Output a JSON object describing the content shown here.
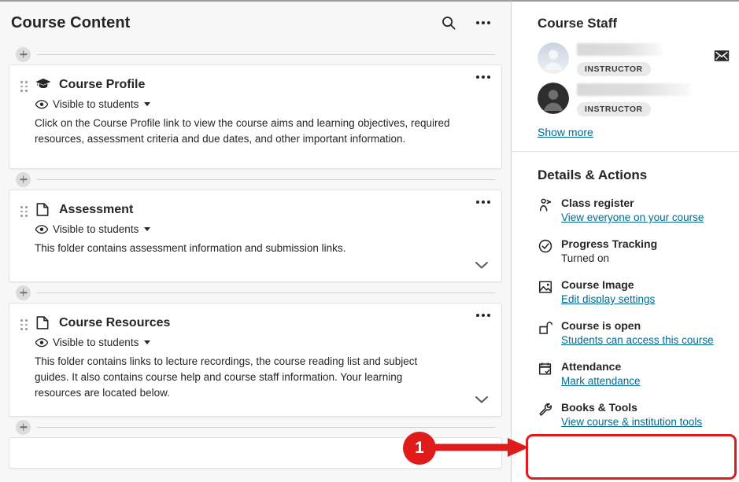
{
  "main": {
    "title": "Course Content",
    "header_icons": [
      {
        "name": "search-icon",
        "label": "Search"
      },
      {
        "name": "more-options-icon",
        "label": "More options"
      }
    ],
    "add_button_label": "+",
    "cards": [
      {
        "icon": "graduation-cap-icon",
        "title": "Course Profile",
        "visibility": "Visible to students",
        "description": "Click on the Course Profile link to view the course aims and learning objectives, required resources, assessment criteria and due dates, and other important information.",
        "expandable": false
      },
      {
        "icon": "folder-icon",
        "title": "Assessment",
        "visibility": "Visible to students",
        "description": "This folder contains assessment information and submission links.",
        "expandable": true
      },
      {
        "icon": "folder-icon",
        "title": "Course Resources",
        "visibility": "Visible to students",
        "description": "This folder contains links to lecture recordings, the course reading list and subject guides. It also contains course help and course staff information. Your learning resources are located below.",
        "expandable": true
      }
    ]
  },
  "sidebar": {
    "staff": {
      "title": "Course Staff",
      "members": [
        {
          "name": "",
          "role": "INSTRUCTOR",
          "avatar": "default-avatar-light",
          "has_mail": true
        },
        {
          "name": "",
          "role": "INSTRUCTOR",
          "avatar": "default-avatar-dark",
          "has_mail": false
        }
      ],
      "show_more_label": "Show more"
    },
    "details": {
      "title": "Details & Actions",
      "items": [
        {
          "icon": "class-register-icon",
          "label": "Class register",
          "sub": "View everyone on your course",
          "sub_is_link": true
        },
        {
          "icon": "check-circle-icon",
          "label": "Progress Tracking",
          "sub": "Turned on",
          "sub_is_link": false
        },
        {
          "icon": "image-icon",
          "label": "Course Image",
          "sub": "Edit display settings",
          "sub_is_link": true
        },
        {
          "icon": "open-lock-icon",
          "label": "Course is open",
          "sub": "Students can access this course",
          "sub_is_link": true
        },
        {
          "icon": "calendar-check-icon",
          "label": "Attendance",
          "sub": "Mark attendance",
          "sub_is_link": true
        },
        {
          "icon": "wrench-icon",
          "label": "Books & Tools",
          "sub": "View course & institution tools",
          "sub_is_link": true
        }
      ]
    }
  },
  "annotation": {
    "badge_number": "1",
    "color": "#e01b1b",
    "target": "Books & Tools"
  },
  "colors": {
    "link": "#006a93",
    "text": "#262626",
    "panel_bg": "#f7f7f7",
    "card_bg": "#ffffff",
    "annotation_red": "#e01b1b"
  }
}
